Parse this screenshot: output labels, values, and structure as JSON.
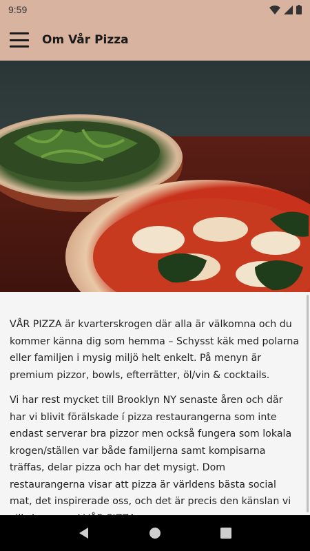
{
  "status": {
    "time": "9:59"
  },
  "app_bar": {
    "title": "Om Vår Pizza",
    "menu_icon": "hamburger-menu-icon"
  },
  "hero": {
    "image": "two-pizzas-on-table"
  },
  "content": {
    "paragraphs": [
      "VÅR PIZZA är kvarterskrogen där alla är välkomna och du kommer känna dig som hemma – Schysst käk med polarna eller familjen i mysig miljö helt enkelt. På menyn är premium pizzor, bowls, efterrätter, öl/vin & cocktails.",
      "Vi har rest mycket till Brooklyn NY senaste åren och där har vi blivit förälskade í pizza restaurangerna som inte endast serverar bra pizzor men också fungera som lokala krogen/ställen var både familjerna samt kompisarna träffas, delar pizza och har det mysigt. Dom restaurangerna visar att pizza är världens bästa social mat, det inspirerade oss, och det är precis den känslan vi vill skapa med VÅR PIZZA."
    ]
  },
  "colors": {
    "app_bar": "#d8b4a0",
    "background": "#f5f5f5",
    "nav_bar": "#000000"
  },
  "nav": {
    "back": "back-icon",
    "home": "home-icon",
    "recents": "recents-icon"
  }
}
